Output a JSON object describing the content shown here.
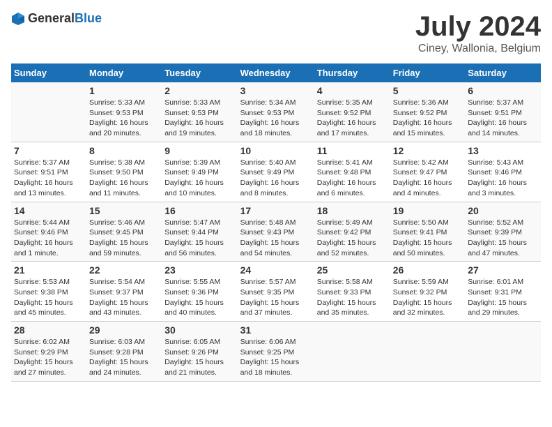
{
  "logo": {
    "general": "General",
    "blue": "Blue"
  },
  "title": "July 2024",
  "subtitle": "Ciney, Wallonia, Belgium",
  "days_header": [
    "Sunday",
    "Monday",
    "Tuesday",
    "Wednesday",
    "Thursday",
    "Friday",
    "Saturday"
  ],
  "weeks": [
    [
      {
        "day": "",
        "sunrise": "",
        "sunset": "",
        "daylight": ""
      },
      {
        "day": "1",
        "sunrise": "Sunrise: 5:33 AM",
        "sunset": "Sunset: 9:53 PM",
        "daylight": "Daylight: 16 hours and 20 minutes."
      },
      {
        "day": "2",
        "sunrise": "Sunrise: 5:33 AM",
        "sunset": "Sunset: 9:53 PM",
        "daylight": "Daylight: 16 hours and 19 minutes."
      },
      {
        "day": "3",
        "sunrise": "Sunrise: 5:34 AM",
        "sunset": "Sunset: 9:53 PM",
        "daylight": "Daylight: 16 hours and 18 minutes."
      },
      {
        "day": "4",
        "sunrise": "Sunrise: 5:35 AM",
        "sunset": "Sunset: 9:52 PM",
        "daylight": "Daylight: 16 hours and 17 minutes."
      },
      {
        "day": "5",
        "sunrise": "Sunrise: 5:36 AM",
        "sunset": "Sunset: 9:52 PM",
        "daylight": "Daylight: 16 hours and 15 minutes."
      },
      {
        "day": "6",
        "sunrise": "Sunrise: 5:37 AM",
        "sunset": "Sunset: 9:51 PM",
        "daylight": "Daylight: 16 hours and 14 minutes."
      }
    ],
    [
      {
        "day": "7",
        "sunrise": "Sunrise: 5:37 AM",
        "sunset": "Sunset: 9:51 PM",
        "daylight": "Daylight: 16 hours and 13 minutes."
      },
      {
        "day": "8",
        "sunrise": "Sunrise: 5:38 AM",
        "sunset": "Sunset: 9:50 PM",
        "daylight": "Daylight: 16 hours and 11 minutes."
      },
      {
        "day": "9",
        "sunrise": "Sunrise: 5:39 AM",
        "sunset": "Sunset: 9:49 PM",
        "daylight": "Daylight: 16 hours and 10 minutes."
      },
      {
        "day": "10",
        "sunrise": "Sunrise: 5:40 AM",
        "sunset": "Sunset: 9:49 PM",
        "daylight": "Daylight: 16 hours and 8 minutes."
      },
      {
        "day": "11",
        "sunrise": "Sunrise: 5:41 AM",
        "sunset": "Sunset: 9:48 PM",
        "daylight": "Daylight: 16 hours and 6 minutes."
      },
      {
        "day": "12",
        "sunrise": "Sunrise: 5:42 AM",
        "sunset": "Sunset: 9:47 PM",
        "daylight": "Daylight: 16 hours and 4 minutes."
      },
      {
        "day": "13",
        "sunrise": "Sunrise: 5:43 AM",
        "sunset": "Sunset: 9:46 PM",
        "daylight": "Daylight: 16 hours and 3 minutes."
      }
    ],
    [
      {
        "day": "14",
        "sunrise": "Sunrise: 5:44 AM",
        "sunset": "Sunset: 9:46 PM",
        "daylight": "Daylight: 16 hours and 1 minute."
      },
      {
        "day": "15",
        "sunrise": "Sunrise: 5:46 AM",
        "sunset": "Sunset: 9:45 PM",
        "daylight": "Daylight: 15 hours and 59 minutes."
      },
      {
        "day": "16",
        "sunrise": "Sunrise: 5:47 AM",
        "sunset": "Sunset: 9:44 PM",
        "daylight": "Daylight: 15 hours and 56 minutes."
      },
      {
        "day": "17",
        "sunrise": "Sunrise: 5:48 AM",
        "sunset": "Sunset: 9:43 PM",
        "daylight": "Daylight: 15 hours and 54 minutes."
      },
      {
        "day": "18",
        "sunrise": "Sunrise: 5:49 AM",
        "sunset": "Sunset: 9:42 PM",
        "daylight": "Daylight: 15 hours and 52 minutes."
      },
      {
        "day": "19",
        "sunrise": "Sunrise: 5:50 AM",
        "sunset": "Sunset: 9:41 PM",
        "daylight": "Daylight: 15 hours and 50 minutes."
      },
      {
        "day": "20",
        "sunrise": "Sunrise: 5:52 AM",
        "sunset": "Sunset: 9:39 PM",
        "daylight": "Daylight: 15 hours and 47 minutes."
      }
    ],
    [
      {
        "day": "21",
        "sunrise": "Sunrise: 5:53 AM",
        "sunset": "Sunset: 9:38 PM",
        "daylight": "Daylight: 15 hours and 45 minutes."
      },
      {
        "day": "22",
        "sunrise": "Sunrise: 5:54 AM",
        "sunset": "Sunset: 9:37 PM",
        "daylight": "Daylight: 15 hours and 43 minutes."
      },
      {
        "day": "23",
        "sunrise": "Sunrise: 5:55 AM",
        "sunset": "Sunset: 9:36 PM",
        "daylight": "Daylight: 15 hours and 40 minutes."
      },
      {
        "day": "24",
        "sunrise": "Sunrise: 5:57 AM",
        "sunset": "Sunset: 9:35 PM",
        "daylight": "Daylight: 15 hours and 37 minutes."
      },
      {
        "day": "25",
        "sunrise": "Sunrise: 5:58 AM",
        "sunset": "Sunset: 9:33 PM",
        "daylight": "Daylight: 15 hours and 35 minutes."
      },
      {
        "day": "26",
        "sunrise": "Sunrise: 5:59 AM",
        "sunset": "Sunset: 9:32 PM",
        "daylight": "Daylight: 15 hours and 32 minutes."
      },
      {
        "day": "27",
        "sunrise": "Sunrise: 6:01 AM",
        "sunset": "Sunset: 9:31 PM",
        "daylight": "Daylight: 15 hours and 29 minutes."
      }
    ],
    [
      {
        "day": "28",
        "sunrise": "Sunrise: 6:02 AM",
        "sunset": "Sunset: 9:29 PM",
        "daylight": "Daylight: 15 hours and 27 minutes."
      },
      {
        "day": "29",
        "sunrise": "Sunrise: 6:03 AM",
        "sunset": "Sunset: 9:28 PM",
        "daylight": "Daylight: 15 hours and 24 minutes."
      },
      {
        "day": "30",
        "sunrise": "Sunrise: 6:05 AM",
        "sunset": "Sunset: 9:26 PM",
        "daylight": "Daylight: 15 hours and 21 minutes."
      },
      {
        "day": "31",
        "sunrise": "Sunrise: 6:06 AM",
        "sunset": "Sunset: 9:25 PM",
        "daylight": "Daylight: 15 hours and 18 minutes."
      },
      {
        "day": "",
        "sunrise": "",
        "sunset": "",
        "daylight": ""
      },
      {
        "day": "",
        "sunrise": "",
        "sunset": "",
        "daylight": ""
      },
      {
        "day": "",
        "sunrise": "",
        "sunset": "",
        "daylight": ""
      }
    ]
  ]
}
